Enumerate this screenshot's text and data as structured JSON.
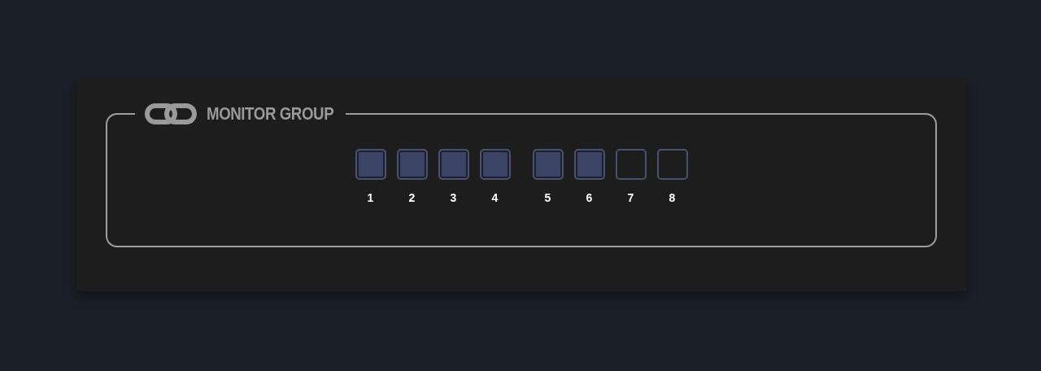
{
  "panel": {
    "title": "MONITOR GROUP",
    "groups": [
      {
        "channels": [
          {
            "label": "1",
            "checked": true
          },
          {
            "label": "2",
            "checked": true
          },
          {
            "label": "3",
            "checked": true
          },
          {
            "label": "4",
            "checked": true
          }
        ]
      },
      {
        "channels": [
          {
            "label": "5",
            "checked": true
          },
          {
            "label": "6",
            "checked": true
          },
          {
            "label": "7",
            "checked": false
          },
          {
            "label": "8",
            "checked": false
          }
        ]
      }
    ]
  }
}
